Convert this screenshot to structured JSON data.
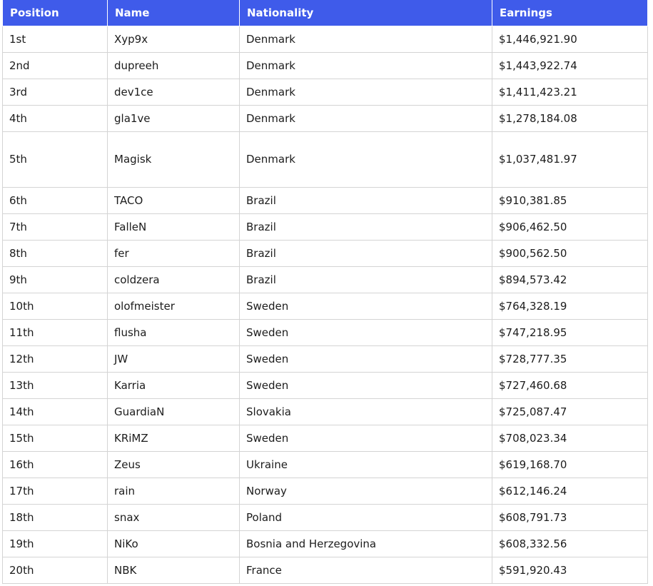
{
  "table": {
    "headers": {
      "position": "Position",
      "name": "Name",
      "nationality": "Nationality",
      "earnings": "Earnings"
    },
    "rows": [
      {
        "position": "1st",
        "name": "Xyp9x",
        "nationality": "Denmark",
        "earnings": "$1,446,921.90"
      },
      {
        "position": "2nd",
        "name": "dupreeh",
        "nationality": "Denmark",
        "earnings": "$1,443,922.74"
      },
      {
        "position": "3rd",
        "name": "dev1ce",
        "nationality": "Denmark",
        "earnings": "$1,411,423.21"
      },
      {
        "position": "4th",
        "name": "gla1ve",
        "nationality": "Denmark",
        "earnings": "$1,278,184.08"
      },
      {
        "position": "5th",
        "name": "Magisk",
        "nationality": "Denmark",
        "earnings": "$1,037,481.97"
      },
      {
        "position": "6th",
        "name": "TACO",
        "nationality": "Brazil",
        "earnings": "$910,381.85"
      },
      {
        "position": "7th",
        "name": "FalleN",
        "nationality": "Brazil",
        "earnings": "$906,462.50"
      },
      {
        "position": "8th",
        "name": "fer",
        "nationality": "Brazil",
        "earnings": "$900,562.50"
      },
      {
        "position": "9th",
        "name": "coldzera",
        "nationality": "Brazil",
        "earnings": "$894,573.42"
      },
      {
        "position": "10th",
        "name": "olofmeister",
        "nationality": "Sweden",
        "earnings": "$764,328.19"
      },
      {
        "position": "11th",
        "name": "flusha",
        "nationality": "Sweden",
        "earnings": "$747,218.95"
      },
      {
        "position": "12th",
        "name": "JW",
        "nationality": "Sweden",
        "earnings": "$728,777.35"
      },
      {
        "position": "13th",
        "name": "Karria",
        "nationality": "Sweden",
        "earnings": "$727,460.68"
      },
      {
        "position": "14th",
        "name": "GuardiaN",
        "nationality": "Slovakia",
        "earnings": "$725,087.47"
      },
      {
        "position": "15th",
        "name": "KRiMZ",
        "nationality": "Sweden",
        "earnings": "$708,023.34"
      },
      {
        "position": "16th",
        "name": "Zeus",
        "nationality": "Ukraine",
        "earnings": "$619,168.70"
      },
      {
        "position": "17th",
        "name": "rain",
        "nationality": "Norway",
        "earnings": "$612,146.24"
      },
      {
        "position": "18th",
        "name": "snax",
        "nationality": "Poland",
        "earnings": "$608,791.73"
      },
      {
        "position": "19th",
        "name": "NiKo",
        "nationality": "Bosnia and Herzegovina",
        "earnings": "$608,332.56"
      },
      {
        "position": "20th",
        "name": "NBK",
        "nationality": "France",
        "earnings": "$591,920.43"
      }
    ]
  },
  "colors": {
    "header_background": "#3f5bea",
    "header_text": "#ffffff",
    "cell_border": "#d4d4d4",
    "cell_text": "#1c1c1c"
  }
}
